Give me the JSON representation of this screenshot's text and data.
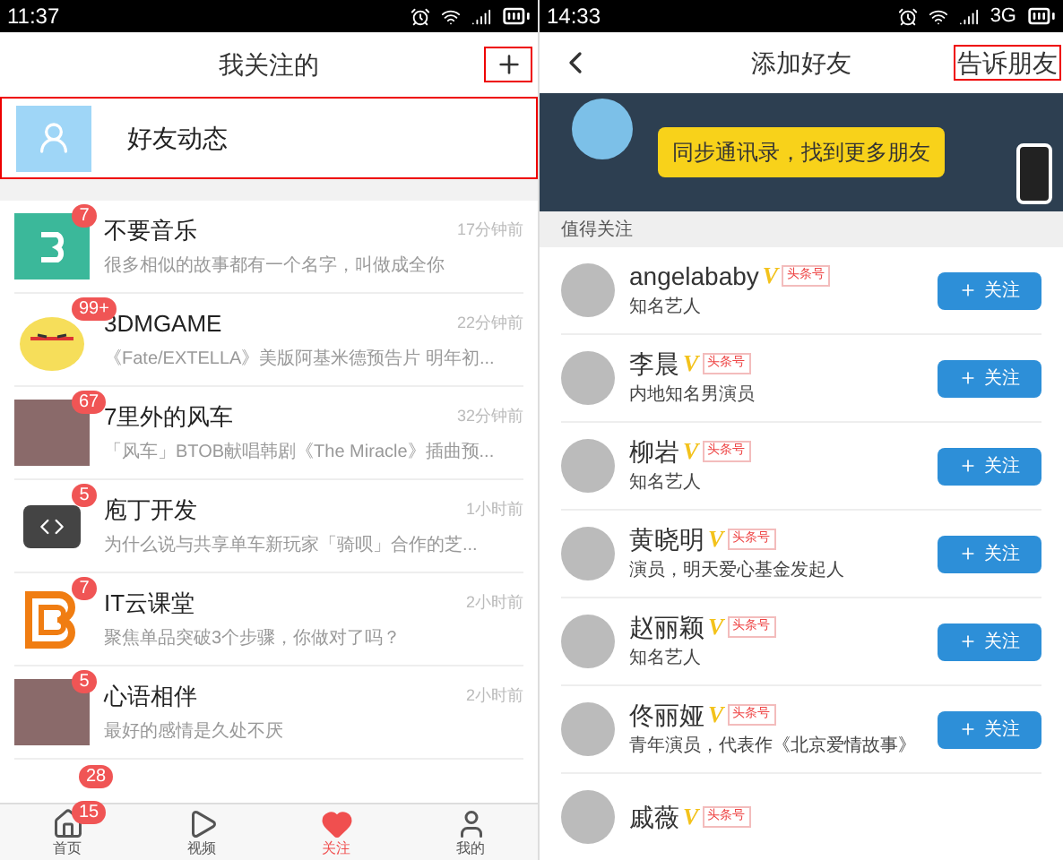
{
  "left": {
    "status_bar": {
      "time": "11:37"
    },
    "header": {
      "title": "我关注的"
    },
    "friends_feed": {
      "label": "好友动态"
    },
    "feeds": [
      {
        "name": "不要音乐",
        "preview": "很多相似的故事都有一个名字，叫做成全你",
        "time": "17分钟前",
        "badge": "7"
      },
      {
        "name": "3DMGAME",
        "preview": "《Fate/EXTELLA》美版阿基米德预告片 明年初...",
        "time": "22分钟前",
        "badge": "99+"
      },
      {
        "name": "7里外的风车",
        "preview": "「风车」BTOB献唱韩剧《The Miracle》插曲预...",
        "time": "32分钟前",
        "badge": "67"
      },
      {
        "name": "庖丁开发",
        "preview": "为什么说与共享单车新玩家「骑呗」合作的芝...",
        "time": "1小时前",
        "badge": "5"
      },
      {
        "name": "IT云课堂",
        "preview": "聚焦单品突破3个步骤，你做对了吗？",
        "time": "2小时前",
        "badge": "7"
      },
      {
        "name": "心语相伴",
        "preview": "最好的感情是久处不厌",
        "time": "2小时前",
        "badge": "5"
      }
    ],
    "partial_feed": {
      "badge": "28"
    },
    "tab_bar": [
      {
        "label": "首页",
        "selected": false,
        "badge": "15"
      },
      {
        "label": "视频",
        "selected": false
      },
      {
        "label": "关注",
        "selected": true
      },
      {
        "label": "我的",
        "selected": false
      }
    ]
  },
  "right": {
    "status_bar": {
      "time": "14:33",
      "network": "3G"
    },
    "header": {
      "title": "添加好友",
      "action": "告诉朋友"
    },
    "banner": {
      "text": "同步通讯录，找到更多朋友"
    },
    "section_title": "值得关注",
    "people": [
      {
        "name": "angelababy",
        "mark": "V",
        "tag": "头条号",
        "description": "知名艺人",
        "button": "关注"
      },
      {
        "name": "李晨",
        "mark": "V",
        "tag": "头条号",
        "description": "内地知名男演员",
        "button": "关注"
      },
      {
        "name": "柳岩",
        "mark": "V",
        "tag": "头条号",
        "description": "知名艺人",
        "button": "关注"
      },
      {
        "name": "黄晓明",
        "mark": "V",
        "tag": "头条号",
        "description": "演员，明天爱心基金发起人",
        "button": "关注"
      },
      {
        "name": "赵丽颖",
        "mark": "V",
        "tag": "头条号",
        "description": "知名艺人",
        "button": "关注"
      },
      {
        "name": "佟丽娅",
        "mark": "V",
        "tag": "头条号",
        "description": "青年演员，代表作《北京爱情故事》",
        "button": "关注"
      },
      {
        "name": "戚薇",
        "mark": "V",
        "tag": "头条号"
      }
    ]
  }
}
